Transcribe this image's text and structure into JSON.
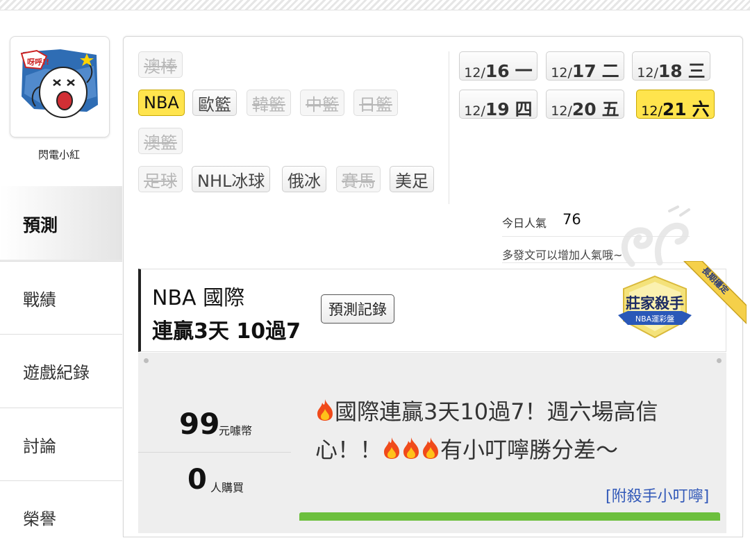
{
  "user": {
    "name": "閃電小紅",
    "avatar_caption": "呀呼!!"
  },
  "sidebar": {
    "items": [
      {
        "label": "預測",
        "active": true
      },
      {
        "label": "戰績"
      },
      {
        "label": "遊戲紀錄"
      },
      {
        "label": "討論"
      },
      {
        "label": "榮譽"
      }
    ]
  },
  "sports": {
    "row1": [
      {
        "label": "澳棒",
        "state": "disabled"
      }
    ],
    "row2": [
      {
        "label": "NBA",
        "state": "selected"
      },
      {
        "label": "歐籃",
        "state": "enabled"
      },
      {
        "label": "韓籃",
        "state": "disabled"
      },
      {
        "label": "中籃",
        "state": "disabled"
      },
      {
        "label": "日籃",
        "state": "disabled"
      }
    ],
    "row3": [
      {
        "label": "澳籃",
        "state": "disabled"
      }
    ],
    "row4": [
      {
        "label": "足球",
        "state": "disabled"
      },
      {
        "label": "NHL冰球",
        "state": "enabled"
      },
      {
        "label": "俄冰",
        "state": "enabled"
      },
      {
        "label": "賽馬",
        "state": "disabled"
      },
      {
        "label": "美足",
        "state": "enabled"
      }
    ]
  },
  "dates": [
    {
      "month": "12/",
      "day": "16",
      "weekday": "一"
    },
    {
      "month": "12/",
      "day": "17",
      "weekday": "二"
    },
    {
      "month": "12/",
      "day": "18",
      "weekday": "三"
    },
    {
      "month": "12/",
      "day": "19",
      "weekday": "四"
    },
    {
      "month": "12/",
      "day": "20",
      "weekday": "五"
    },
    {
      "month": "12/",
      "day": "21",
      "weekday": "六",
      "selected": true
    }
  ],
  "popularity": {
    "label": "今日人氣",
    "value": "76",
    "hint": "多發文可以增加人氣哦~"
  },
  "prediction": {
    "league": "NBA 國際",
    "streak": "連贏3天 10過7",
    "record_button": "預測記錄",
    "badge_title": "莊家殺手",
    "badge_subtitle": "NBA運彩盤",
    "ribbon": "長期穩定",
    "price": "99",
    "price_unit": "元噱幣",
    "buyers": "0",
    "buyers_unit": "人購買",
    "desc_part1": "國際連贏3天10過7！週六場高信心！！",
    "desc_part2": "有小叮嚀勝分差～",
    "attach_link": "[附殺手小叮嚀]"
  },
  "colors": {
    "accent": "#ffe44d",
    "link": "#3158b8",
    "progress": "#6cbf3d"
  }
}
